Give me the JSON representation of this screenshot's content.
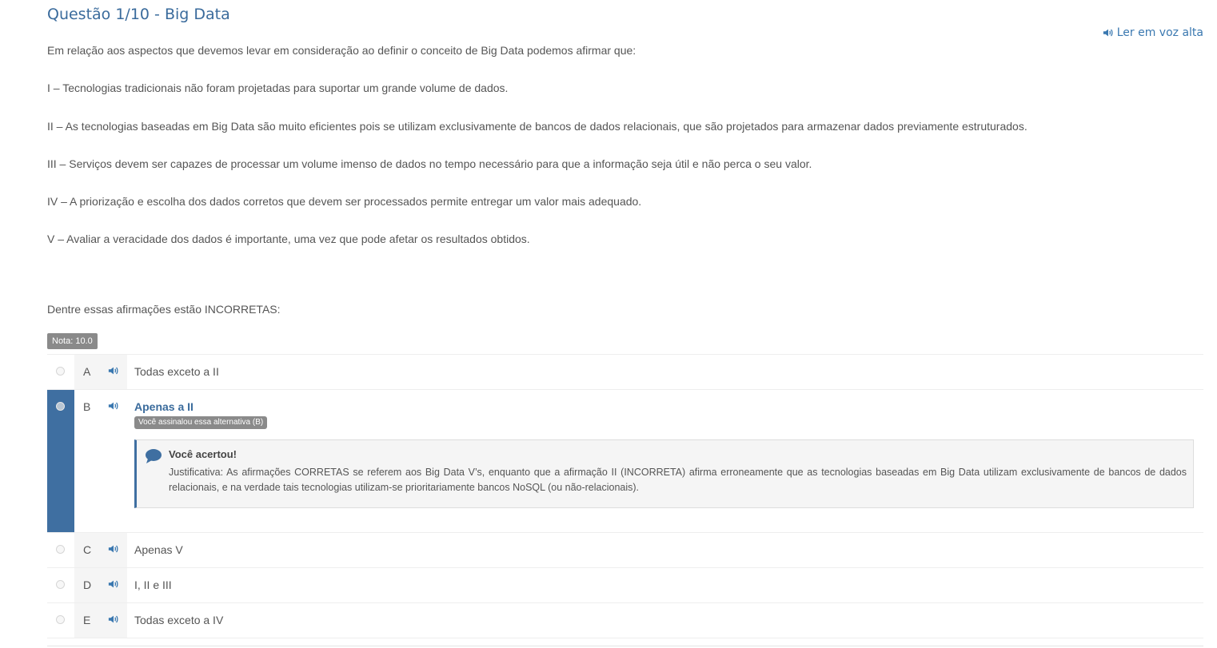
{
  "question": {
    "title": "Questão 1/10 - Big Data",
    "tts_label": "Ler em voz alta",
    "intro": "Em relação aos aspectos que devemos levar em consideração ao definir o conceito de Big Data podemos afirmar que:",
    "statements": [
      "I – Tecnologias tradicionais não foram projetadas para suportar um grande volume de dados.",
      "II – As tecnologias baseadas em Big Data são muito eficientes pois se utilizam exclusivamente de bancos de dados relacionais, que são projetados para armazenar dados previamente estruturados.",
      "III – Serviços devem ser capazes de processar um volume imenso de dados no tempo necessário para que a informação seja útil e não perca o seu valor.",
      "IV – A priorização e escolha dos dados corretos que devem ser processados permite entregar um valor mais adequado.",
      "V – Avaliar a veracidade dos dados é importante, uma vez que pode afetar os resultados obtidos."
    ],
    "prompt": "Dentre essas afirmações estão INCORRETAS:",
    "grade_badge": "Nota: 10.0"
  },
  "options": [
    {
      "letter": "A",
      "text": "Todas exceto a II"
    },
    {
      "letter": "B",
      "text": "Apenas a II",
      "selected_badge": "Você assinalou essa alternativa (B)"
    },
    {
      "letter": "C",
      "text": "Apenas V"
    },
    {
      "letter": "D",
      "text": "I, II e III"
    },
    {
      "letter": "E",
      "text": "Todas exceto a IV"
    }
  ],
  "feedback": {
    "title": "Você acertou!",
    "text": "Justificativa: As afirmações CORRETAS se referem aos Big Data V’s, enquanto que a afirmação II (INCORRETA) afirma erroneamente que as tecnologias baseadas em Big Data utilizam exclusivamente de bancos de dados relacionais, e na verdade tais tecnologias utilizam-se prioritariamente bancos NoSQL (ou não-relacionais)."
  },
  "colors": {
    "accent": "#3f6fa1",
    "link": "#3a78b0",
    "badge": "#8a8a8a"
  },
  "icons": {
    "speaker": "speaker-icon",
    "comment": "comment-icon"
  }
}
